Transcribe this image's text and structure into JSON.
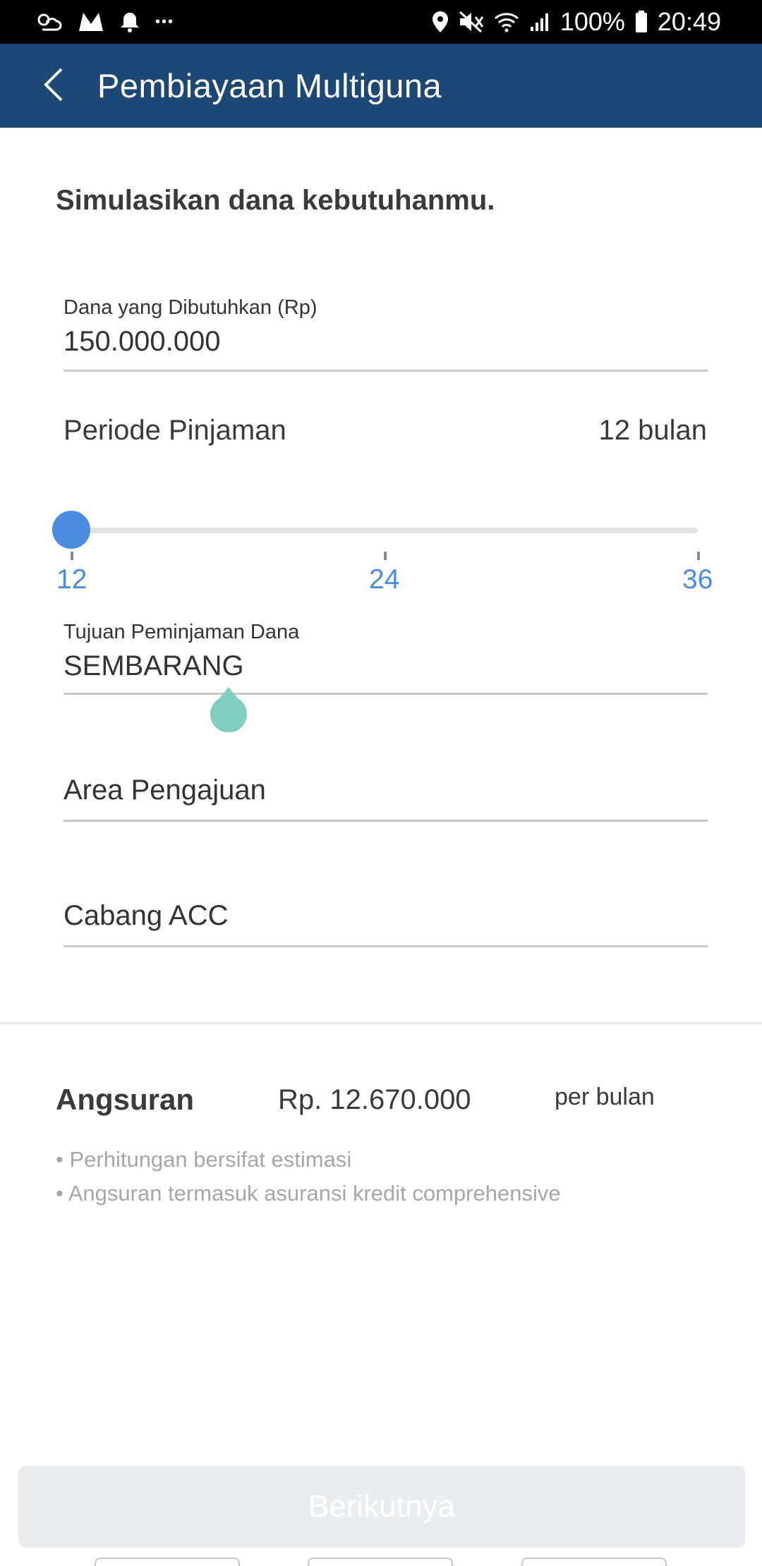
{
  "status_bar": {
    "battery": "100%",
    "time": "20:49",
    "more_dots": "•••",
    "icons_left": [
      "weather-icon",
      "m-app-icon",
      "bell-icon",
      "more-icon"
    ],
    "icons_right": [
      "location-icon",
      "mute-icon",
      "wifi-icon",
      "signal-icon",
      "battery-icon"
    ]
  },
  "app_bar": {
    "title": "Pembiayaan Multiguna",
    "back_icon": "chevron-left-icon",
    "background": "#1d4875"
  },
  "main": {
    "heading": "Simulasikan dana kebutuhanmu.",
    "amount_field": {
      "label": "Dana yang Dibutuhkan (Rp)",
      "value": "150.000.000"
    },
    "period": {
      "label": "Periode Pinjaman",
      "value_text": "12 bulan",
      "slider": {
        "min": 12,
        "max": 36,
        "value": 12,
        "ticks": [
          "12",
          "24",
          "36"
        ],
        "accent": "#4a8de0"
      }
    },
    "purpose_field": {
      "label": "Tujuan Peminjaman Dana",
      "value": "SEMBARANG"
    },
    "area_field": {
      "placeholder": "Area Pengajuan"
    },
    "branch_field": {
      "placeholder": "Cabang ACC"
    }
  },
  "result": {
    "label": "Angsuran",
    "value": "Rp. 12.670.000",
    "unit": "per bulan",
    "notes": [
      "• Perhitungan bersifat estimasi",
      "• Angsuran termasuk asuransi kredit comprehensive"
    ]
  },
  "footer": {
    "next_button": "Berikutnya"
  }
}
